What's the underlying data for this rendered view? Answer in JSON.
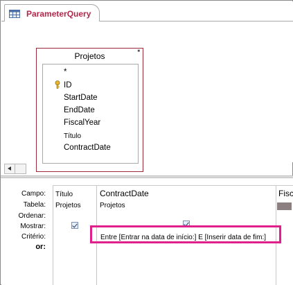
{
  "tab": {
    "title": "ParameterQuery"
  },
  "table": {
    "title": "Projetos",
    "fields": [
      "*",
      "ID",
      "StartDate",
      "EndDate",
      "FiscalYear",
      "Título",
      "ContractDate"
    ]
  },
  "grid": {
    "row_labels": {
      "campo": "Campo:",
      "tabela": "Tabela:",
      "ordenar": "Ordenar:",
      "mostrar": "Mostrar:",
      "criterio": "Critério:",
      "or": "or:"
    },
    "columns": [
      {
        "campo": "Título",
        "tabela": "Projetos",
        "mostrar": true,
        "criterio": ""
      },
      {
        "campo": "ContractDate",
        "tabela": "Projetos",
        "mostrar": true,
        "criterio": "Entre [Entrar na data de início:] E [Inserir data de fim:]"
      },
      {
        "campo": "Fisca",
        "tabela": "",
        "mostrar": false,
        "criterio": ""
      }
    ]
  },
  "colors": {
    "highlight": "#e0208a",
    "tab_text": "#b5264b",
    "table_border": "#9c2a3a"
  }
}
